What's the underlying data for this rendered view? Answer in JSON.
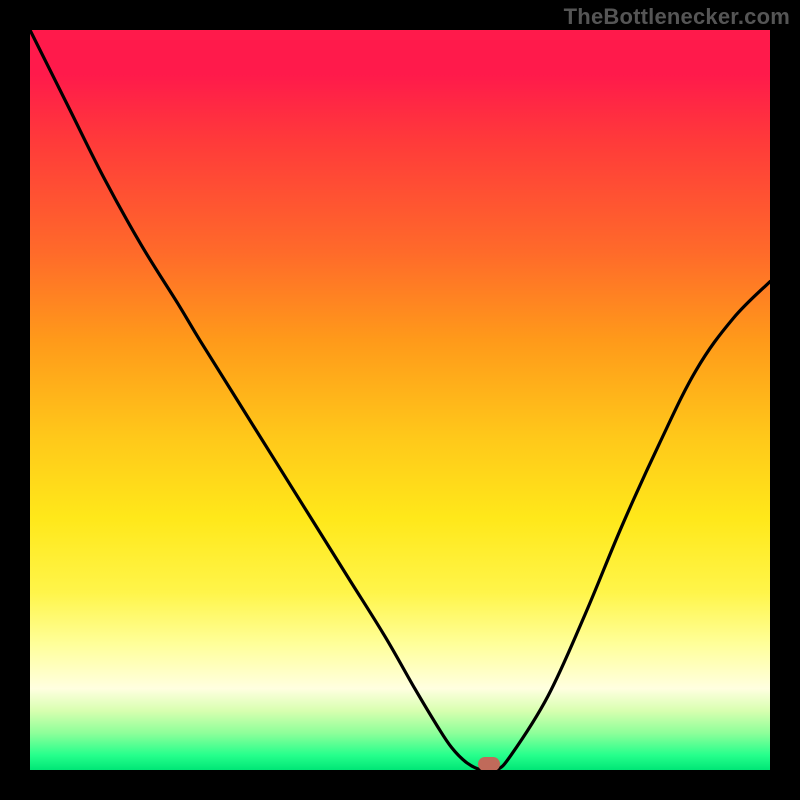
{
  "attribution": "TheBottlenecker.com",
  "chart_data": {
    "type": "line",
    "title": "",
    "xlabel": "",
    "ylabel": "",
    "xlim": [
      0,
      100
    ],
    "ylim": [
      0,
      100
    ],
    "x": [
      0,
      5,
      10,
      15,
      20,
      23,
      28,
      33,
      38,
      43,
      48,
      52,
      55,
      57,
      59,
      61,
      63,
      65,
      70,
      75,
      80,
      85,
      90,
      95,
      100
    ],
    "values": [
      100,
      90,
      80,
      71,
      63,
      58,
      50,
      42,
      34,
      26,
      18,
      11,
      6,
      3,
      1,
      0,
      0,
      2,
      10,
      21,
      33,
      44,
      54,
      61,
      66
    ],
    "marker": {
      "x": 62,
      "y": 0
    },
    "gradient_meaning": "top=bad (red), bottom=good (green)"
  },
  "colors": {
    "curve": "#000000",
    "marker": "#c06a5a",
    "attribution": "#555555"
  }
}
